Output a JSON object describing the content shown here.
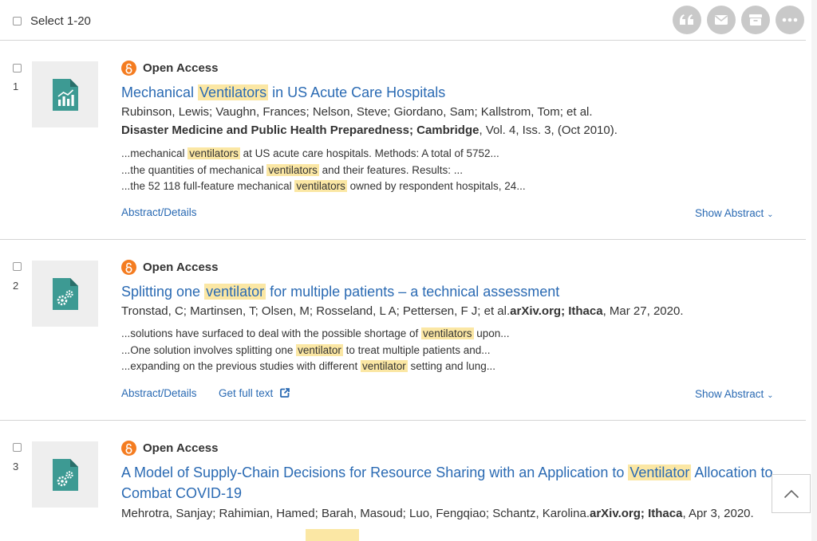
{
  "header": {
    "select_label": "Select 1-20",
    "tools": [
      "quote-icon",
      "email-icon",
      "save-icon",
      "more-icon"
    ]
  },
  "open_access_label": "Open Access",
  "records": [
    {
      "number": "1",
      "thumb_icon": "chart-document-icon",
      "title_before": "Mechanical ",
      "title_hl": "Ventilators",
      "title_after": " in US Acute Care Hospitals",
      "authors": "Rubinson, Lewis; Vaughn, Frances; Nelson, Steve; Giordano, Sam; Kallstrom, Tom; et al.",
      "source_bold": "Disaster Medicine and Public Health Preparedness; Cambridge",
      "source_rest": ",  Vol. 4, Iss. 3, (Oct 2010).",
      "snippets": [
        {
          "before": "...mechanical ",
          "hl": "ventilators",
          "after": " at US acute care hospitals. Methods: A total of 5752..."
        },
        {
          "before": "...the quantities of mechanical ",
          "hl": "ventilators",
          "after": " and their features. Results: ..."
        },
        {
          "before": "...the 52 118 full-feature mechanical ",
          "hl": "ventilators",
          "after": " owned by respondent hospitals, 24..."
        }
      ],
      "abstract_link": "Abstract/Details",
      "show_abstract": "Show Abstract"
    },
    {
      "number": "2",
      "thumb_icon": "gears-document-icon",
      "title_before": "Splitting one ",
      "title_hl": "ventilator",
      "title_after": " for multiple patients – a technical assessment",
      "authors": "Tronstad, C; Martinsen, T; Olsen, M; Rosseland, L A; Pettersen, F J; et al.",
      "source_bold": "arXiv.org; Ithaca",
      "source_rest": ", Mar 27, 2020.",
      "snippets": [
        {
          "before": "...solutions have surfaced to deal with the possible shortage of ",
          "hl": "ventilators",
          "after": " upon..."
        },
        {
          "before": "...One solution involves splitting one ",
          "hl": "ventilator",
          "after": " to treat multiple patients and..."
        },
        {
          "before": "...expanding on the previous studies with different ",
          "hl": "ventilator",
          "after": " setting and lung..."
        }
      ],
      "abstract_link": "Abstract/Details",
      "full_text_link": "Get full text",
      "show_abstract": "Show Abstract"
    },
    {
      "number": "3",
      "thumb_icon": "gears-document-icon",
      "title_before": "A Model of Supply-Chain Decisions for Resource Sharing with an Application to ",
      "title_hl": "Ventilator",
      "title_after": " Allocation to Combat COVID-19",
      "authors": "Mehrotra, Sanjay; Rahimian, Hamed; Barah, Masoud; Luo, Fengqiao; Schantz, Karolina.",
      "source_bold": "arXiv.org; Ithaca",
      "source_rest": ", Apr 3, 2020."
    }
  ],
  "colors": {
    "link": "#2a6ab3",
    "highlight": "#fbe7a4",
    "open_access": "#f47c20",
    "doc_icon": "#3d9a93",
    "tool_button": "#c9c9c9"
  }
}
